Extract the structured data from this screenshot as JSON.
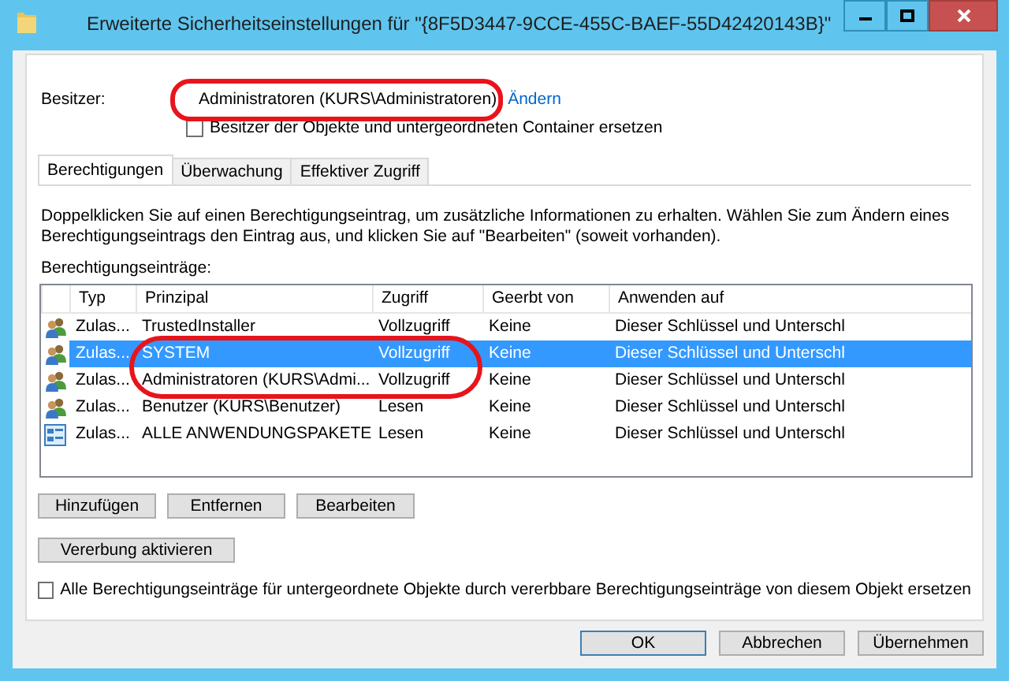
{
  "window": {
    "title": "Erweiterte Sicherheitseinstellungen für \"{8F5D3447-9CCE-455C-BAEF-55D42420143B}\""
  },
  "owner": {
    "label": "Besitzer:",
    "value": "Administratoren (KURS\\Administratoren)",
    "link": "Ändern",
    "highlighted": true
  },
  "replace_owner": {
    "label": "Besitzer der Objekte und untergeordneten Container ersetzen",
    "checked": false
  },
  "tabs": [
    {
      "label": "Berechtigungen",
      "selected": true
    },
    {
      "label": "Überwachung",
      "selected": false
    },
    {
      "label": "Effektiver Zugriff",
      "selected": false
    }
  ],
  "info_text": "Doppelklicken Sie auf einen Berechtigungseintrag, um zusätzliche Informationen zu erhalten. Wählen Sie zum Ändern eines Berechtigungseintrags den Eintrag aus, und klicken Sie auf \"Bearbeiten\" (soweit vorhanden).",
  "table": {
    "label": "Berechtigungseinträge:",
    "columns": [
      "Typ",
      "Prinzipal",
      "Zugriff",
      "Geerbt von",
      "Anwenden auf"
    ],
    "rows": [
      {
        "kind": "user",
        "selected": false,
        "highlighted": false,
        "cells": [
          "Zulas...",
          "TrustedInstaller",
          "Vollzugriff",
          "Keine",
          "Dieser Schlüssel und Unterschl"
        ]
      },
      {
        "kind": "user",
        "selected": true,
        "highlighted": true,
        "cells": [
          "Zulas...",
          "SYSTEM",
          "Vollzugriff",
          "Keine",
          "Dieser Schlüssel und Unterschl"
        ]
      },
      {
        "kind": "user",
        "selected": false,
        "highlighted": true,
        "cells": [
          "Zulas...",
          "Administratoren (KURS\\Admi...",
          "Vollzugriff",
          "Keine",
          "Dieser Schlüssel und Unterschl"
        ]
      },
      {
        "kind": "user",
        "selected": false,
        "highlighted": false,
        "cells": [
          "Zulas...",
          "Benutzer (KURS\\Benutzer)",
          "Lesen",
          "Keine",
          "Dieser Schlüssel und Unterschl"
        ]
      },
      {
        "kind": "package",
        "selected": false,
        "highlighted": false,
        "cells": [
          "Zulas...",
          "ALLE ANWENDUNGSPAKETE",
          "Lesen",
          "Keine",
          "Dieser Schlüssel und Unterschl"
        ]
      }
    ]
  },
  "entry_buttons": [
    "Hinzufügen",
    "Entfernen",
    "Bearbeiten"
  ],
  "inheritance_button": "Vererbung aktivieren",
  "replace_entries": {
    "label": "Alle Berechtigungseinträge für untergeordnete Objekte durch vererbbare Berechtigungseinträge von diesem Objekt ersetzen",
    "checked": false
  },
  "dialog_buttons": [
    {
      "label": "OK",
      "default": true
    },
    {
      "label": "Abbrechen",
      "default": false
    },
    {
      "label": "Übernehmen",
      "default": false
    }
  ]
}
